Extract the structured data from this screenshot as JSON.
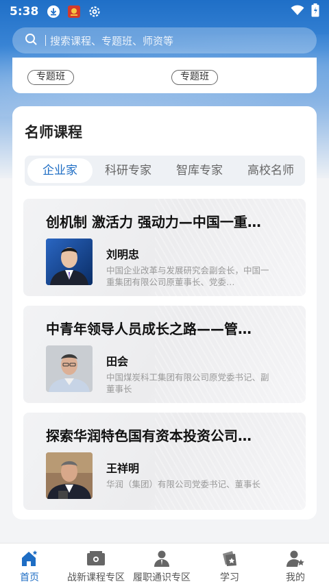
{
  "status_bar": {
    "time": "5:38"
  },
  "search": {
    "placeholder": "搜索课程、专题班、师资等"
  },
  "topic_tags": [
    "专题班",
    "专题班"
  ],
  "section": {
    "title": "名师课程",
    "tabs": [
      {
        "label": "企业家",
        "active": true
      },
      {
        "label": "科研专家",
        "active": false
      },
      {
        "label": "智库专家",
        "active": false
      },
      {
        "label": "高校名师",
        "active": false
      }
    ]
  },
  "courses": [
    {
      "title": "创机制 激活力 强动力—中国一重…",
      "lecturer": "刘明忠",
      "description": "中国企业改革与发展研究会副会长，中国一重集团有限公司原董事长、党委…"
    },
    {
      "title": "中青年领导人员成长之路——管…",
      "lecturer": "田会",
      "description": "中国煤炭科工集团有限公司原党委书记、副董事长"
    },
    {
      "title": "探索华润特色国有资本投资公司…",
      "lecturer": "王祥明",
      "description": "华润（集团）有限公司党委书记、董事长"
    }
  ],
  "bottom_nav": [
    {
      "label": "首页",
      "icon": "home-icon",
      "active": true
    },
    {
      "label": "战新课程专区",
      "icon": "courses-icon",
      "active": false
    },
    {
      "label": "履职通识专区",
      "icon": "person-icon",
      "active": false
    },
    {
      "label": "学习",
      "icon": "study-icon",
      "active": false
    },
    {
      "label": "我的",
      "icon": "profile-icon",
      "active": false
    }
  ],
  "colors": {
    "accent": "#1e6dc4",
    "header_blue": "#1f6fc7"
  }
}
